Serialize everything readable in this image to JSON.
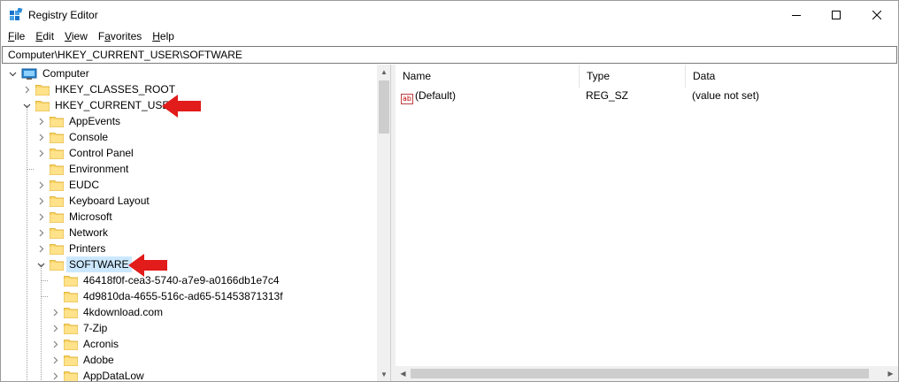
{
  "window": {
    "title": "Registry Editor",
    "icon": "registry-icon",
    "controls": {
      "minimize": "minimize-icon",
      "maximize": "maximize-icon",
      "close": "close-icon"
    }
  },
  "menu": [
    {
      "label": "File",
      "accel": "F"
    },
    {
      "label": "Edit",
      "accel": "E"
    },
    {
      "label": "View",
      "accel": "V"
    },
    {
      "label": "Favorites",
      "accel": "a"
    },
    {
      "label": "Help",
      "accel": "H"
    }
  ],
  "address": {
    "path": "Computer\\HKEY_CURRENT_USER\\SOFTWARE"
  },
  "tree": {
    "root": {
      "label": "Computer",
      "icon": "computer-icon",
      "expanded": true
    },
    "nodes": [
      {
        "label": "HKEY_CLASSES_ROOT",
        "level": 1,
        "expander": "collapsed"
      },
      {
        "label": "HKEY_CURRENT_USER",
        "level": 1,
        "expander": "expanded"
      },
      {
        "label": "AppEvents",
        "level": 2,
        "expander": "collapsed"
      },
      {
        "label": "Console",
        "level": 2,
        "expander": "collapsed"
      },
      {
        "label": "Control Panel",
        "level": 2,
        "expander": "collapsed"
      },
      {
        "label": "Environment",
        "level": 2,
        "expander": "none"
      },
      {
        "label": "EUDC",
        "level": 2,
        "expander": "collapsed"
      },
      {
        "label": "Keyboard Layout",
        "level": 2,
        "expander": "collapsed"
      },
      {
        "label": "Microsoft",
        "level": 2,
        "expander": "collapsed"
      },
      {
        "label": "Network",
        "level": 2,
        "expander": "collapsed"
      },
      {
        "label": "Printers",
        "level": 2,
        "expander": "collapsed"
      },
      {
        "label": "SOFTWARE",
        "level": 2,
        "expander": "expanded",
        "selected": true
      },
      {
        "label": "46418f0f-cea3-5740-a7e9-a0166db1e7c4",
        "level": 3,
        "expander": "none"
      },
      {
        "label": "4d9810da-4655-516c-ad65-51453871313f",
        "level": 3,
        "expander": "none"
      },
      {
        "label": "4kdownload.com",
        "level": 3,
        "expander": "collapsed"
      },
      {
        "label": "7-Zip",
        "level": 3,
        "expander": "collapsed"
      },
      {
        "label": "Acronis",
        "level": 3,
        "expander": "collapsed"
      },
      {
        "label": "Adobe",
        "level": 3,
        "expander": "collapsed"
      },
      {
        "label": "AppDataLow",
        "level": 3,
        "expander": "collapsed"
      }
    ]
  },
  "list": {
    "columns": [
      "Name",
      "Type",
      "Data"
    ],
    "rows": [
      {
        "icon": "string-value-icon",
        "name": "(Default)",
        "type": "REG_SZ",
        "data": "(value not set)"
      }
    ]
  },
  "annotations": {
    "arrow_color": "#e21b1b",
    "selection_color": "#cce8ff"
  }
}
